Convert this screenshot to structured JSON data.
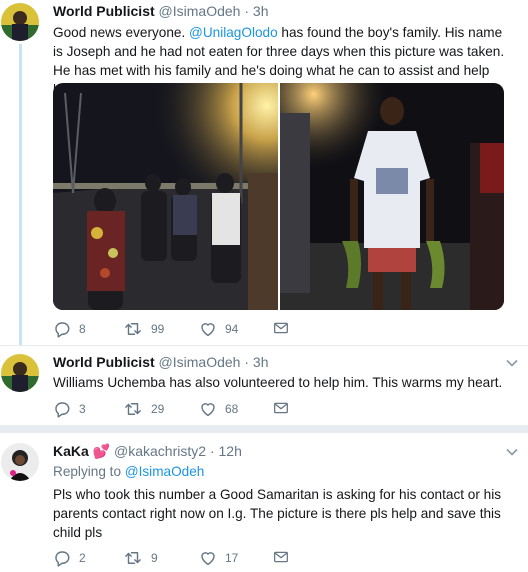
{
  "tweets": [
    {
      "author": "World Publicist",
      "handle": "@IsimaOdeh",
      "dot": "·",
      "time": "3h",
      "text_pre": "Good news everyone. ",
      "mention": "@UnilagOlodo",
      "text_post": " has found the boy's family. His name is Joseph and he had not eaten for three days when this picture was taken. He has met with his family and he's doing what he can to assist and help him out.",
      "replies": "8",
      "retweets": "99",
      "likes": "94"
    },
    {
      "author": "World Publicist",
      "handle": "@IsimaOdeh",
      "dot": "·",
      "time": "3h",
      "text": "Williams Uchemba has also volunteered to help him. This warms my heart.",
      "replies": "3",
      "retweets": "29",
      "likes": "68"
    },
    {
      "author": "KaKa",
      "emoji": "💕",
      "handle": "@kakachristy2",
      "dot": "·",
      "time": "12h",
      "replying_prefix": "Replying to ",
      "replying_to": "@IsimaOdeh",
      "text": "Pls who took this number a Good Samaritan is asking for his contact or his parents contact right now on I.g. The picture is there pls help and save this child pls",
      "replies": "2",
      "retweets": "9",
      "likes": "17"
    }
  ],
  "icons": {
    "reply": "reply-icon",
    "retweet": "retweet-icon",
    "like": "heart-icon",
    "message": "envelope-icon",
    "menu": "chevron-down-icon"
  },
  "colors": {
    "link": "#1b95e0",
    "thread_line": "#c4e3f6",
    "meta": "#657786",
    "divider": "#e6ecf0"
  }
}
